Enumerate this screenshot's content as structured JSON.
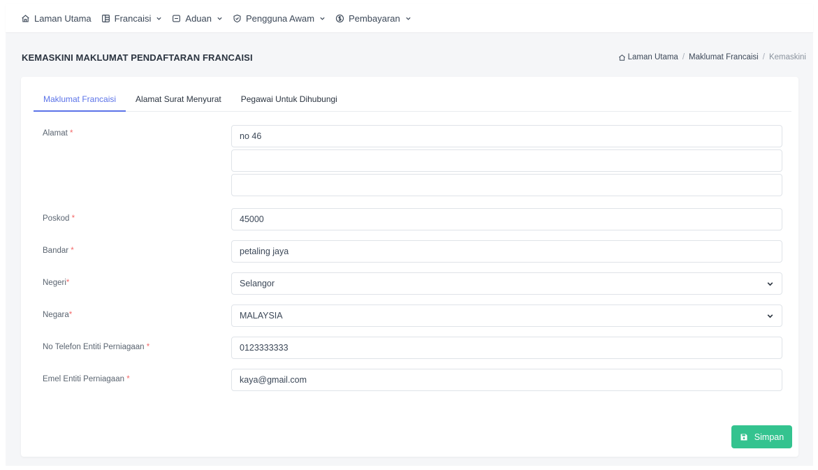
{
  "nav": {
    "items": [
      {
        "label": "Laman Utama",
        "icon": "home-icon",
        "dropdown": false
      },
      {
        "label": "Francaisi",
        "icon": "layout-icon",
        "dropdown": true
      },
      {
        "label": "Aduan",
        "icon": "message-icon",
        "dropdown": true
      },
      {
        "label": "Pengguna Awam",
        "icon": "shield-icon",
        "dropdown": true
      },
      {
        "label": "Pembayaran",
        "icon": "currency-icon",
        "dropdown": true
      }
    ]
  },
  "page": {
    "title": "KEMASKINI MAKLUMAT PENDAFTARAN FRANCAISI"
  },
  "breadcrumb": {
    "items": [
      "Laman Utama",
      "Maklumat Francaisi",
      "Kemaskini"
    ],
    "separator": "/"
  },
  "tabs": [
    {
      "label": "Maklumat Francaisi",
      "active": true
    },
    {
      "label": "Alamat Surat Menyurat",
      "active": false
    },
    {
      "label": "Pegawai Untuk Dihubungi",
      "active": false
    }
  ],
  "form": {
    "required_mark": "*",
    "alamat": {
      "label": "Alamat ",
      "line1": "no 46",
      "line2": "",
      "line3": ""
    },
    "poskod": {
      "label": "Poskod ",
      "value": "45000"
    },
    "bandar": {
      "label": "Bandar ",
      "value": "petaling jaya"
    },
    "negeri": {
      "label": "Negeri",
      "value": "Selangor"
    },
    "negara": {
      "label": "Negara",
      "value": "MALAYSIA"
    },
    "telefon": {
      "label": "No Telefon Entiti Perniagaan ",
      "value": "0123333333"
    },
    "emel": {
      "label": "Emel Entiti Perniagaan ",
      "value": "kaya@gmail.com"
    }
  },
  "actions": {
    "save_label": "Simpan",
    "save_icon": "save-icon"
  },
  "colors": {
    "accent": "#5b73e8",
    "required": "#f46a6a",
    "save": "#34c38f"
  }
}
